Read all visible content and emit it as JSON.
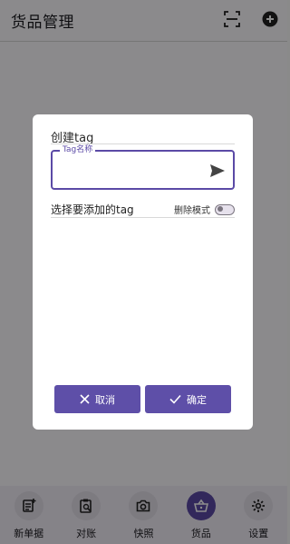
{
  "appbar": {
    "title": "货品管理",
    "scan_icon": "scan-icon",
    "add_icon": "add-circle-icon"
  },
  "dialog": {
    "title": "创建tag",
    "tag_field": {
      "legend": "Tag名称",
      "value": "",
      "send_icon": "send-icon"
    },
    "select_label": "选择要添加的tag",
    "delete_mode_label": "删除模式",
    "delete_mode_on": false,
    "cancel_label": "取消",
    "confirm_label": "确定"
  },
  "bottom_nav": [
    {
      "label": "新单据",
      "icon": "new-doc-icon",
      "active": false
    },
    {
      "label": "对账",
      "icon": "reconcile-icon",
      "active": false
    },
    {
      "label": "快照",
      "icon": "camera-icon",
      "active": false
    },
    {
      "label": "货品",
      "icon": "basket-icon",
      "active": true
    },
    {
      "label": "设置",
      "icon": "settings-icon",
      "active": false
    }
  ],
  "colors": {
    "primary": "#5b4aa6",
    "scrim": "#000000",
    "nav_bg": "#f3eef8"
  }
}
